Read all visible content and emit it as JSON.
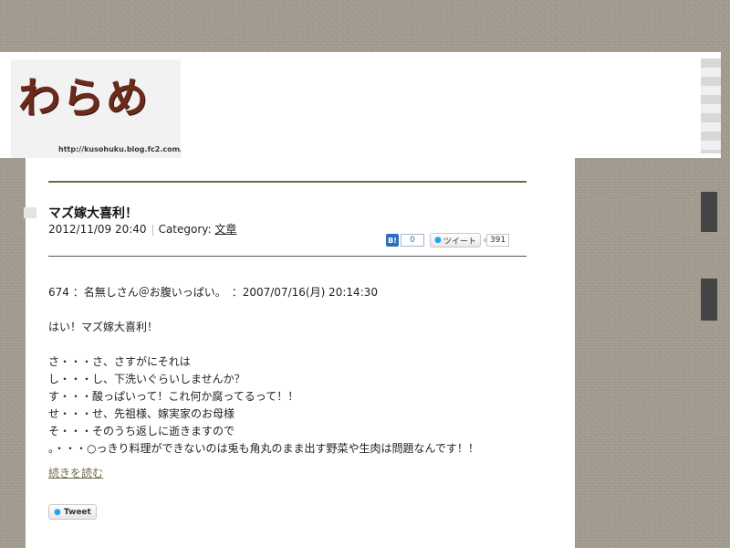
{
  "header": {
    "logo_text": "わらめ",
    "logo_url": "http://kusohuku.blog.fc2.com/"
  },
  "post": {
    "title": "マズ嫁大喜利！",
    "date": "2012/11/09 20:40",
    "category_label": "Category:",
    "category": "文章",
    "hatena_icon": "B!",
    "hatena_count": "0",
    "tweet_button_label": "ツイート",
    "tweet_count": "391",
    "body_lines": [
      "674 ：名無しさん＠お腹いっぱい。　：2007/07/16(月) 20:14:30",
      "",
      "はい！マズ嫁大喜利！",
      "",
      "さ・・・さ、さすがにそれは",
      "し・・・し、下洗いぐらいしませんか？",
      "す・・・酸っぱいって！これ何か腐ってるって！！",
      "せ・・・せ、先祖様、嫁実家のお母様",
      "そ・・・そのうち返しに逝きますので",
      "。・・・○っきり料理ができないのは兎も角丸のまま出す野菜や生肉は問題なんです！！"
    ],
    "read_more": "続きを読む",
    "tweet_label": "Tweet"
  },
  "colors": {
    "accent": "#6e6a4e",
    "logo": "#6b2a1c",
    "background": "#a59c90"
  },
  "icons": {
    "twitter": "twitter-bird-icon",
    "hatena": "hatena-bookmark-icon"
  }
}
